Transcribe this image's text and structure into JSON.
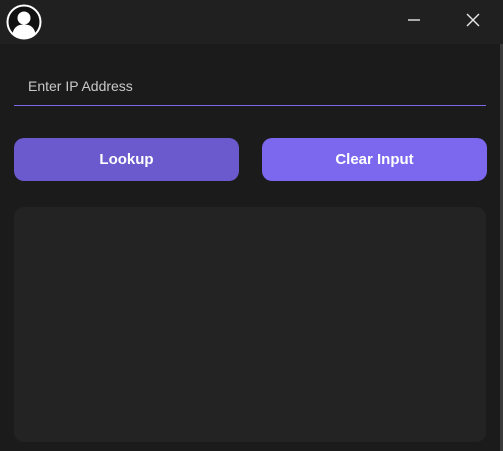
{
  "titlebar": {
    "app_icon": "user-avatar-icon",
    "minimize_icon": "minimize-icon",
    "close_icon": "close-icon"
  },
  "ip_input": {
    "placeholder": "Enter IP Address",
    "value": ""
  },
  "buttons": {
    "lookup_label": "Lookup",
    "clear_label": "Clear Input"
  },
  "output": {
    "text": ""
  },
  "colors": {
    "accent_primary": "#6a5acd",
    "accent_secondary": "#7b68ee",
    "underline": "#7b6ae6",
    "background": "#1b1b1b",
    "panel": "#232323"
  }
}
